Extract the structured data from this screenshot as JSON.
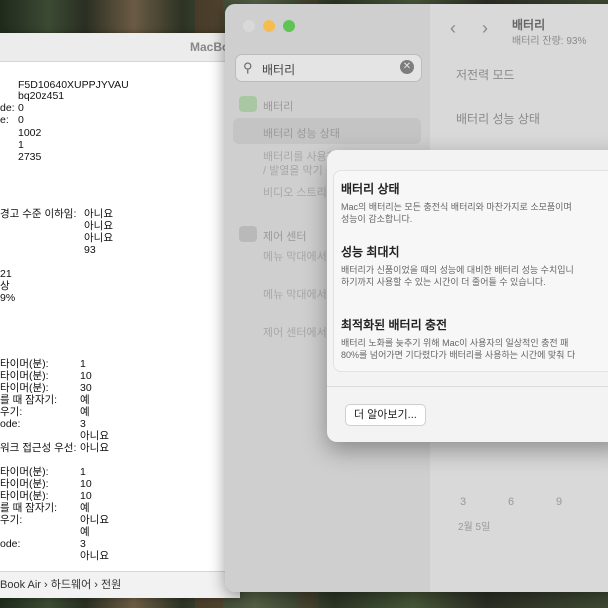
{
  "sysinfo": {
    "window_title": "MacBo",
    "rows": [
      {
        "k": "",
        "v": "F5D10640XUPPJYVAU"
      },
      {
        "k": "",
        "v": "bq20z451"
      },
      {
        "k": "de:",
        "v": "0"
      },
      {
        "k": "e:",
        "v": "0"
      },
      {
        "k": "",
        "v": "1002"
      },
      {
        "k": "",
        "v": "1"
      },
      {
        "k": "",
        "v": "2735"
      },
      {
        "k": "경고 수준 이하임:",
        "v": "아니요"
      },
      {
        "k": "",
        "v": "아니요"
      },
      {
        "k": "",
        "v": "아니요"
      },
      {
        "k": "",
        "v": "93"
      },
      {
        "k": "21",
        "v": ""
      },
      {
        "k": "상",
        "v": ""
      },
      {
        "k": "9%",
        "v": ""
      },
      {
        "k": "타이머(분):",
        "v": "1"
      },
      {
        "k": "타이머(분):",
        "v": "10"
      },
      {
        "k": "타이머(분):",
        "v": "30"
      },
      {
        "k": "를 때 잠자기:",
        "v": "예"
      },
      {
        "k": "우기:",
        "v": "예"
      },
      {
        "k": "ode:",
        "v": "3"
      },
      {
        "k": "",
        "v": "아니요"
      },
      {
        "k": "워크 접근성 우선:",
        "v": "아니요"
      },
      {
        "k": "타이머(분):",
        "v": "1"
      },
      {
        "k": "타이머(분):",
        "v": "10"
      },
      {
        "k": "타이머(분):",
        "v": "10"
      },
      {
        "k": "를 때 잠자기:",
        "v": "예"
      },
      {
        "k": "우기:",
        "v": "아니요"
      },
      {
        "k": "",
        "v": "예"
      },
      {
        "k": "ode:",
        "v": "3"
      },
      {
        "k": "",
        "v": "아니요"
      }
    ],
    "breadcrumb": "Book Air › 하드웨어 › 전원"
  },
  "settings": {
    "search_value": "배터리",
    "sidebar": {
      "battery_label": "배터리",
      "selected_item": "배터리 성능 상태",
      "sub_item_1": "배터리를 사용하는 앱 확인 및 관리 / 발열을 막기 위해",
      "sub_item_2": "비디오 스트리밍",
      "control_center_label": "제어 센터",
      "cc_item_1": "메뉴 막대에서 배터리 보기",
      "cc_item_2": "메뉴 막대에서 배터리 보기",
      "cc_item_3": "제어 센터에서 배터리 보기"
    },
    "main": {
      "title": "배터리",
      "subtitle": "배터리 잔량: 93%",
      "row_1": "저전력 모드",
      "row_2": "배터리 성능 상태",
      "axis_labels": [
        "3",
        "6",
        "9"
      ],
      "date_label": "2월 5일"
    }
  },
  "sheet": {
    "section_1_title": "배터리 상태",
    "section_1_desc_1": "Mac의 배터리는 모든 충전식 배터리와 마찬가지로 소모품이며",
    "section_1_desc_2": "성능이 감소합니다.",
    "section_2_title": "성능 최대치",
    "section_2_desc_1": "배터리가 신품이었을 때의 성능에 대비한 배터리 성능 수치입니",
    "section_2_desc_2": "하기까지 사용할 수 있는 시간이 더 줄어들 수 있습니다.",
    "section_3_title": "최적화된 배터리 충전",
    "section_3_desc_1": "배터리 노화를 늦추기 위해 Mac이 사용자의 일상적인 충전 패",
    "section_3_desc_2": "80%를 넘어가면 기다렸다가 배터리를 사용하는 시간에 맞춰 다",
    "learn_more_label": "더 알아보기..."
  },
  "colors": {
    "traffic_close": "#d9d9d9",
    "traffic_min": "#f5bd4f",
    "traffic_max": "#5fc454"
  }
}
